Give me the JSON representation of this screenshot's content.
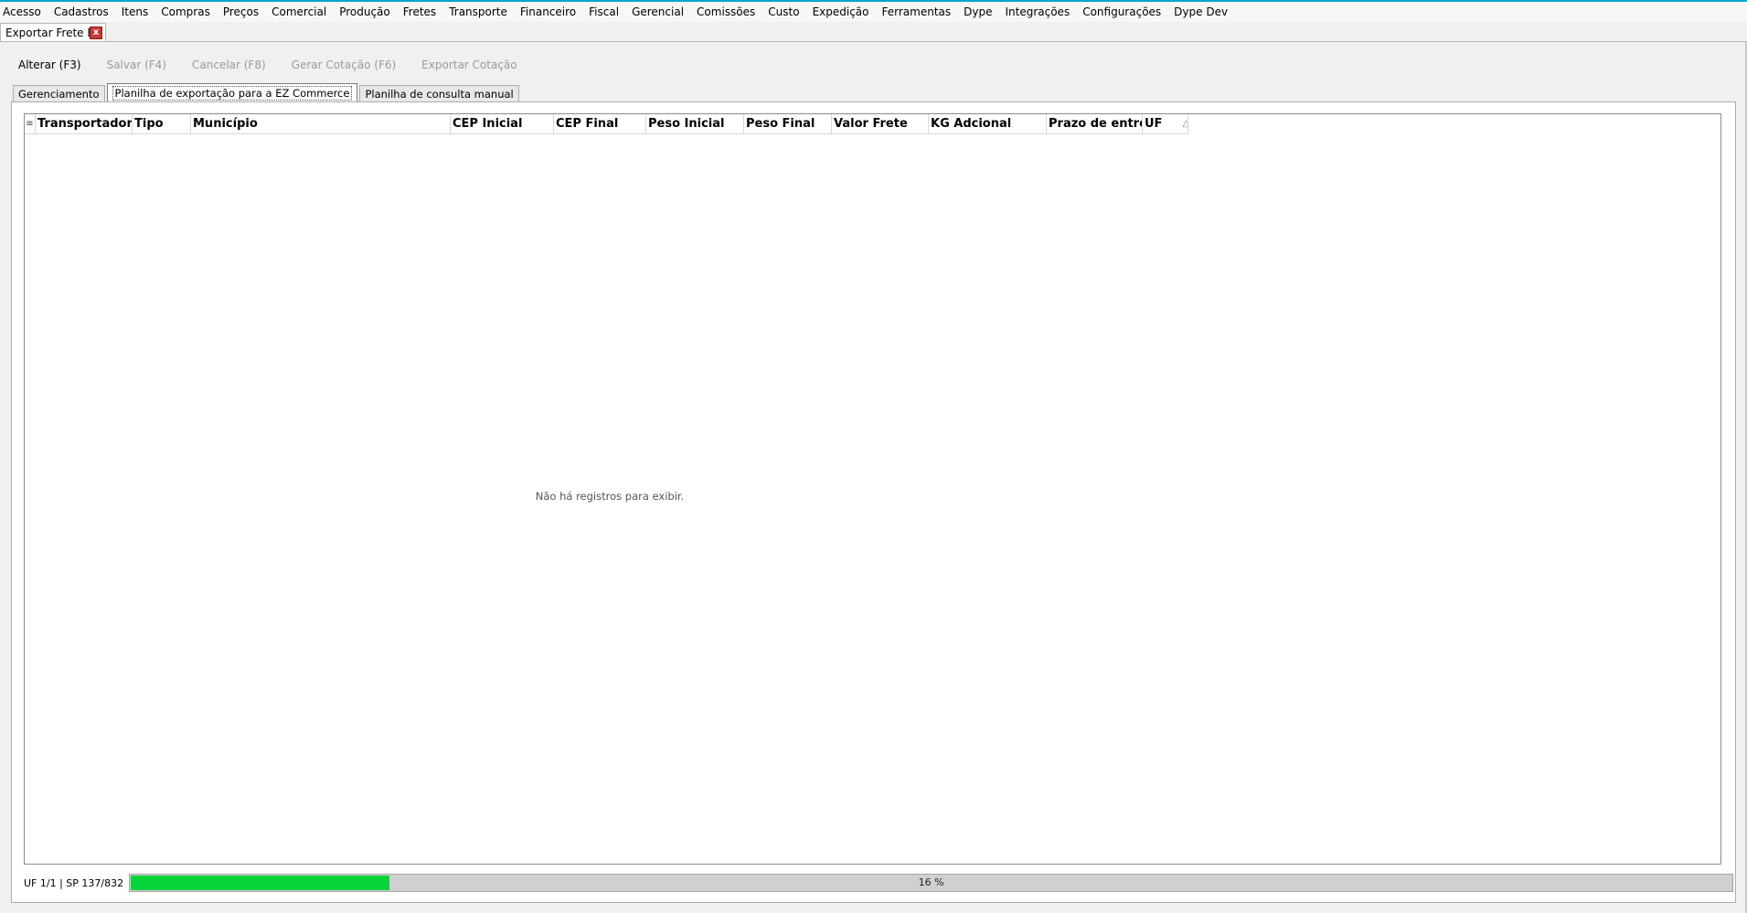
{
  "menu": [
    "Acesso",
    "Cadastros",
    "Itens",
    "Compras",
    "Preços",
    "Comercial",
    "Produção",
    "Fretes",
    "Transporte",
    "Financeiro",
    "Fiscal",
    "Gerencial",
    "Comissões",
    "Custo",
    "Expedição",
    "Ferramentas",
    "Dype",
    "Integrações",
    "Configurações",
    "Dype Dev"
  ],
  "doc_tab": {
    "title": "Exportar Frete EZ",
    "close": "x"
  },
  "toolbar": {
    "alterar": "Alterar (F3)",
    "salvar": "Salvar (F4)",
    "cancelar": "Cancelar (F8)",
    "gerar": "Gerar Cotação (F6)",
    "exportar": "Exportar Cotação"
  },
  "subtabs": {
    "gerenciamento": "Gerenciamento",
    "planilha_export": "Planilha de exportação para a EZ Commerce",
    "planilha_consulta": "Planilha de consulta manual"
  },
  "grid": {
    "columns": [
      "Transportadora",
      "Tipo",
      "Município",
      "CEP Inicial",
      "CEP Final",
      "Peso Inicial",
      "Peso Final",
      "Valor Frete",
      "KG Adcional",
      "Prazo de entrega",
      "UF"
    ],
    "empty_message": "Não há registros para exibir."
  },
  "status": {
    "text": "UF 1/1 | SP 137/832",
    "progress_percent": 16,
    "progress_label": "16 %"
  },
  "colors": {
    "accent_line": "#00a8c8",
    "progress_fill": "#06d33a",
    "close_button": "#c83737"
  }
}
